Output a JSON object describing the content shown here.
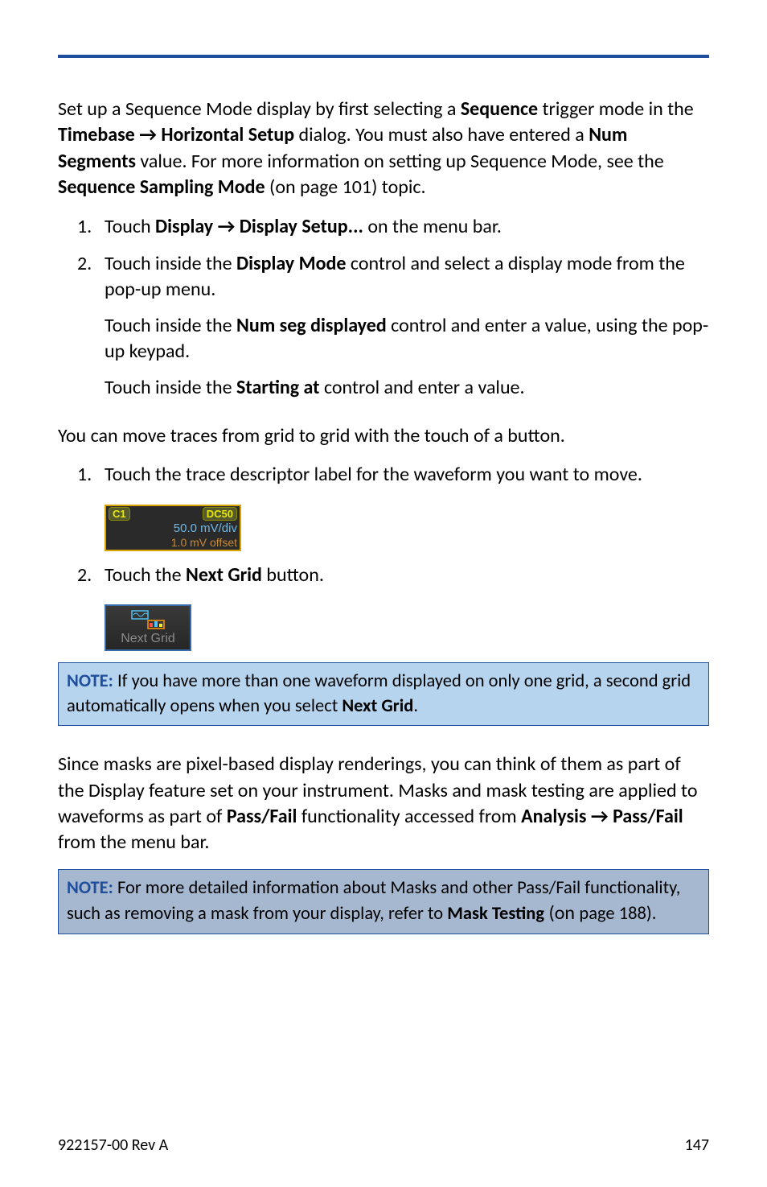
{
  "section1": {
    "intro_pre": "Set up a Sequence Mode display by first selecting a ",
    "intro_b1": "Sequence",
    "intro_mid1": " trigger mode in the ",
    "intro_b2": "Timebase → Horizontal Setup",
    "intro_mid2": "  dialog. You must also have entered a ",
    "intro_b3": "Num Segments",
    "intro_mid3": " value. For more information on setting up Sequence Mode, see the ",
    "intro_b4": "Sequence Sampling Mode",
    "intro_post": " (on page 101) topic.",
    "step1_num": "1.",
    "step1_pre": "Touch ",
    "step1_b": "Display → Display Setup...",
    "step1_post": " on the menu bar.",
    "step2_num": "2.",
    "step2_pre": "Touch inside the ",
    "step2_b": "Display Mode",
    "step2_post": " control and select a display mode from the pop-up menu.",
    "step2b_pre": "Touch inside the ",
    "step2b_b": "Num seg displayed",
    "step2b_post": " control and enter a value, using the pop-up keypad.",
    "step2c_pre": "Touch inside the ",
    "step2c_b": "Starting at",
    "step2c_post": " control and enter a value."
  },
  "section2": {
    "intro": "You can move traces from grid to grid with the touch of a button.",
    "step1_num": "1.",
    "step1": "Touch the trace descriptor label for the waveform you want to move.",
    "step2_num": "2.",
    "step2_pre": "Touch the ",
    "step2_b": "Next Grid",
    "step2_post": " button."
  },
  "descriptor": {
    "channel": "C1",
    "coupling": "DC50",
    "vdiv": "50.0 mV/div",
    "offset": "1.0 mV offset"
  },
  "nextgrid": {
    "label": "Next Grid"
  },
  "note1": {
    "lead": "NOTE:",
    "text_pre": " If you have more than one waveform displayed on only one grid, a second grid automatically opens when you select ",
    "text_b": "Next Grid",
    "text_post": "."
  },
  "section3": {
    "intro_pre": "Since masks are pixel-based display renderings, you can think of them as part of the Display feature set on your instrument. Masks and mask testing are applied to waveforms as part of ",
    "intro_b1": "Pass/Fail",
    "intro_mid": " functionality accessed from ",
    "intro_b2": "Analysis → Pass/Fail",
    "intro_post": " from the menu bar."
  },
  "note2": {
    "lead": "NOTE:",
    "text_pre": " For more detailed information about Masks and other Pass/Fail functionality, such as removing a mask from your display, refer to ",
    "text_b": "Mask Testing",
    "text_mid": " (on ",
    "text_post": "page 188)."
  },
  "footer": {
    "left": "922157-00 Rev A",
    "right": "147"
  }
}
